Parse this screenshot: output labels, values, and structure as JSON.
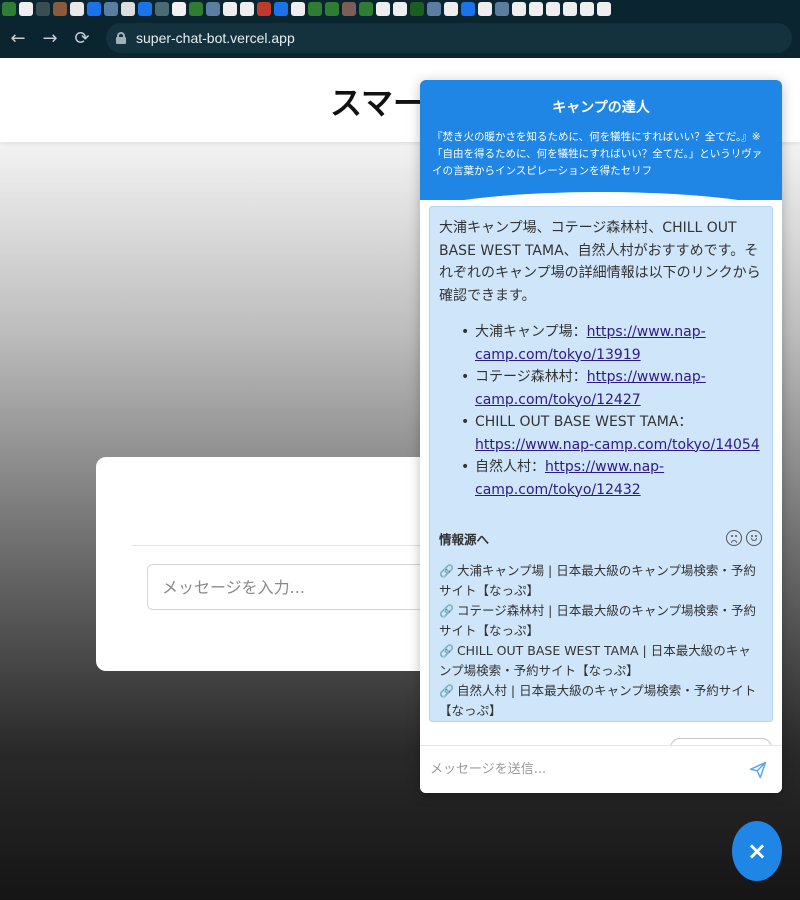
{
  "browser": {
    "url": "super-chat-bot.vercel.app",
    "back_icon": "←",
    "forward_icon": "→",
    "reload_icon": "⟳"
  },
  "page": {
    "title": "スマー",
    "card_input_placeholder": "メッセージを入力..."
  },
  "chat": {
    "title": "キャンプの達人",
    "subtitle": "『焚き火の暖かさを知るために、何を犠牲にすればいい？全てだ。』※「自由を得るために、何を犠牲にすればいい？全てだ。」というリヴァイの言葉からインスピレーションを得たセリフ",
    "message": {
      "intro": "大浦キャンプ場、コテージ森林村、CHILL OUT BASE WEST TAMA、自然人村がおすすめです。それぞれのキャンプ場の詳細情報は以下のリンクから確認できます。",
      "links": [
        {
          "name": "大浦キャンプ場：",
          "url": "https://www.nap-camp.com/tokyo/13919"
        },
        {
          "name": "コテージ森林村：",
          "url": "https://www.nap-camp.com/tokyo/12427"
        },
        {
          "name": "CHILL OUT BASE WEST TAMA：",
          "url": "https://www.nap-camp.com/tokyo/14054"
        },
        {
          "name": "自然人村：",
          "url": "https://www.nap-camp.com/tokyo/12432"
        }
      ],
      "sources_title": "情報源へ",
      "sources": [
        "大浦キャンプ場 | 日本最大級のキャンプ場検索・予約サイト【なっぷ】",
        "コテージ森林村 | 日本最大級のキャンプ場検索・予約サイト【なっぷ】",
        "CHILL OUT BASE WEST TAMA | 日本最大級のキャンプ場検索・予約サイト【なっぷ】",
        "自然人村 | 日本最大級のキャンプ場検索・予約サイト【なっぷ】"
      ]
    },
    "input_placeholder": "メッセージを送信...",
    "close_label": "×"
  },
  "colors": {
    "accent": "#1f86e6",
    "bubble": "#cfe6fa",
    "link": "#2d1a8a"
  }
}
